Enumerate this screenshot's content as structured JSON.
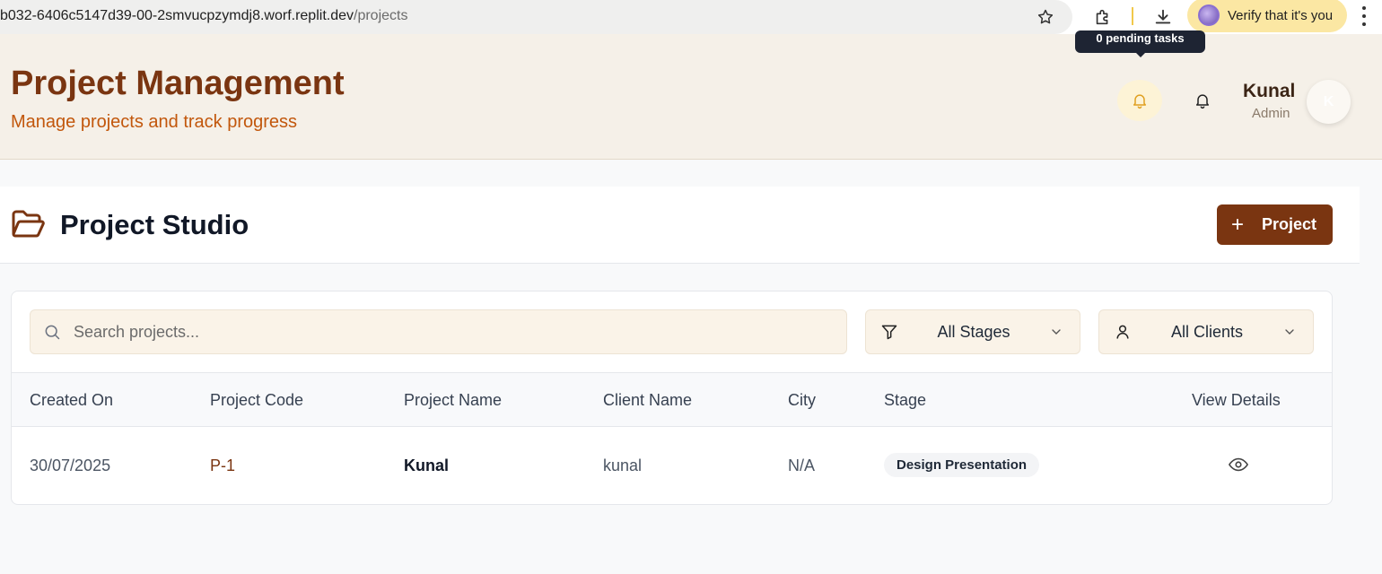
{
  "browser": {
    "url_host": "b032-6406c5147d39-00-2smvucpzymdj8.worf.replit.dev",
    "url_path": "/projects",
    "verify_label": "Verify that it's you"
  },
  "header": {
    "title": "Project Management",
    "subtitle": "Manage projects and track progress",
    "tooltip": "0 pending tasks",
    "user": {
      "name": "Kunal",
      "role": "Admin",
      "initial": "K"
    }
  },
  "studio": {
    "title": "Project Studio",
    "add_button": {
      "icon": "+",
      "label": "Project"
    }
  },
  "filters": {
    "search_placeholder": "Search projects...",
    "stage_value": "All Stages",
    "client_value": "All Clients"
  },
  "table": {
    "headers": [
      "Created On",
      "Project Code",
      "Project Name",
      "Client Name",
      "City",
      "Stage",
      "View Details"
    ],
    "rows": [
      {
        "created_on": "30/07/2025",
        "code": "P-1",
        "name": "Kunal",
        "client": "kunal",
        "city": "N/A",
        "stage": "Design Presentation"
      }
    ]
  },
  "colors": {
    "brand": "#7a3511",
    "accent": "#c2570c",
    "header_bg": "#f5f0e8",
    "input_bg": "#faf3e8"
  },
  "icons": [
    "star-icon",
    "extension-icon",
    "download-icon",
    "bell-icon",
    "folder-open-icon",
    "search-icon",
    "filter-icon",
    "user-icon",
    "chevron-down-icon",
    "eye-icon"
  ]
}
